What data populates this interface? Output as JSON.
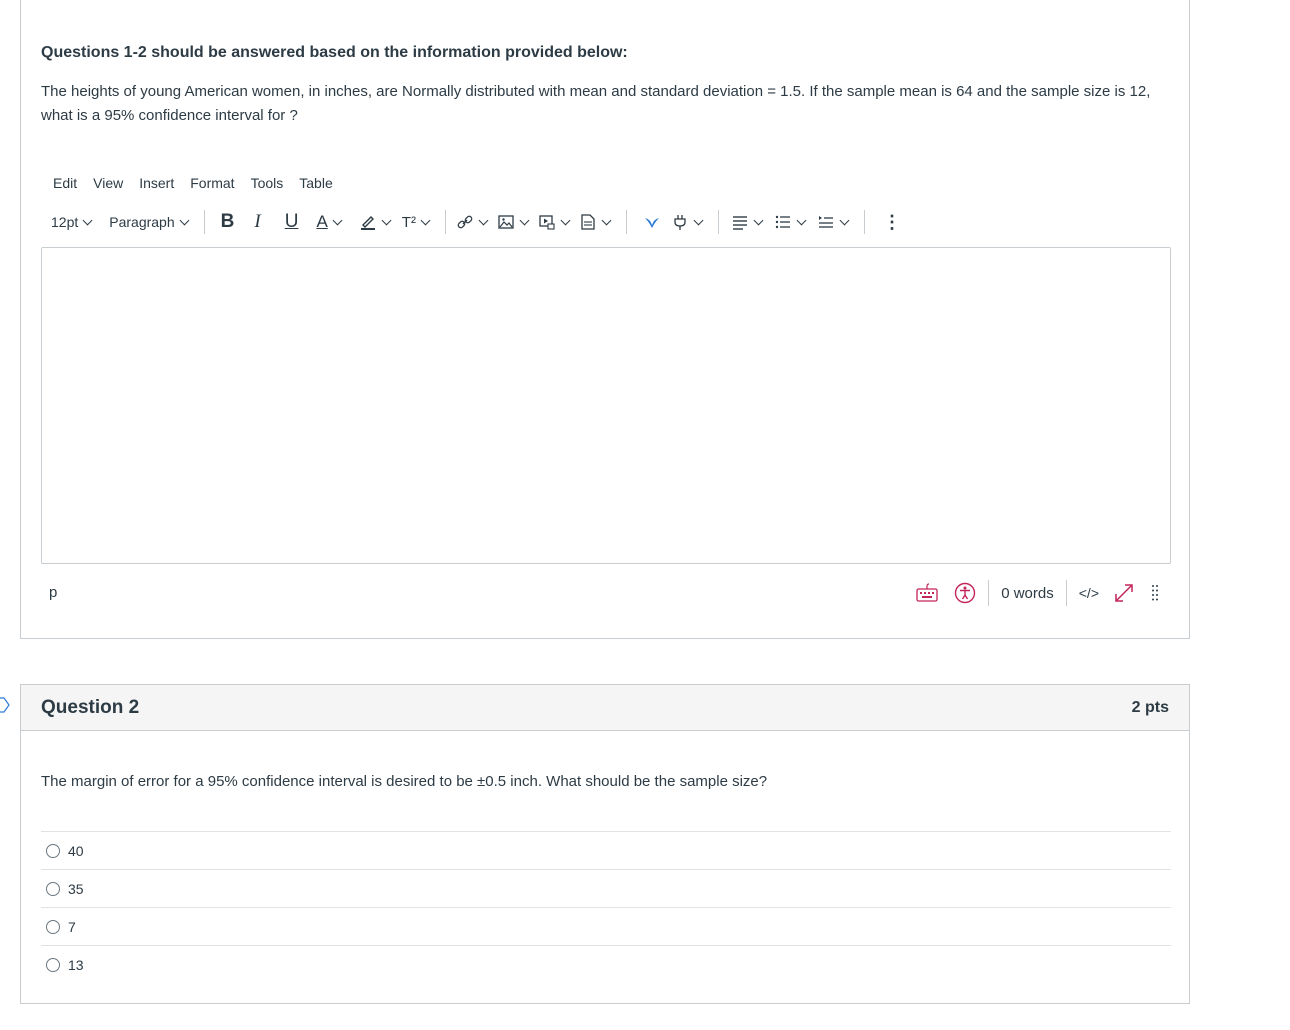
{
  "question1": {
    "intro": "Questions 1-2 should be answered based on the information provided below:",
    "text": "The heights of young American women, in inches, are Normally distributed with mean  and standard deviation  = 1.5. If the sample mean is 64 and the sample size is 12, what is a 95% confidence interval for ?"
  },
  "editor": {
    "menu": [
      "Edit",
      "View",
      "Insert",
      "Format",
      "Tools",
      "Table"
    ],
    "font_size": "12pt",
    "block_format": "Paragraph",
    "bold": "B",
    "italic": "I",
    "underline": "U",
    "text_color": "A",
    "superscript": "T²",
    "status_path": "p",
    "word_count": "0 words",
    "html_editor": "</>",
    "accent_color": "#c3245a"
  },
  "question2": {
    "title": "Question 2",
    "points": "2 pts",
    "text": "The margin of error for a 95% confidence interval is desired to be ±0.5 inch. What should be the sample size?",
    "answers": [
      "40",
      "35",
      "7",
      "13"
    ]
  }
}
